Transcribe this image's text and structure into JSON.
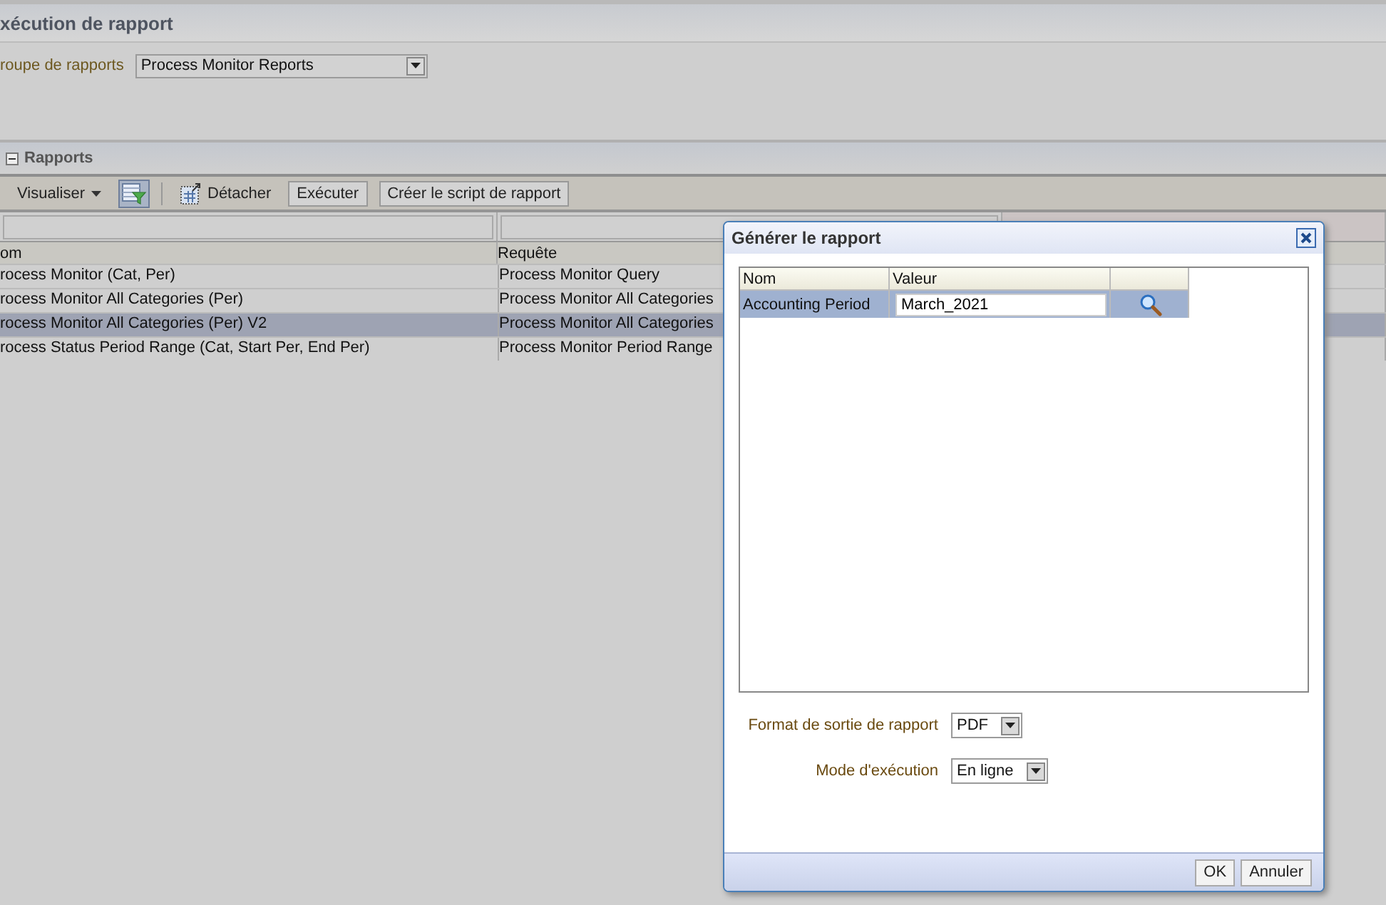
{
  "page": {
    "title": "xécution de rapport",
    "report_group": {
      "label": "roupe de rapports",
      "value": "Process Monitor Reports"
    }
  },
  "section": {
    "title": "Rapports",
    "expanded": true
  },
  "toolbar": {
    "view_menu": "Visualiser",
    "filter_selected": true,
    "detach": "Détacher",
    "buttons": [
      "Exécuter",
      "Créer le script de rapport"
    ]
  },
  "table": {
    "columns": [
      "om",
      "Requête"
    ],
    "rows": [
      {
        "name": "rocess Monitor (Cat, Per)",
        "query": "Process Monitor Query",
        "selected": false
      },
      {
        "name": "rocess Monitor All Categories (Per)",
        "query": "Process Monitor All Categories",
        "selected": false
      },
      {
        "name": "rocess Monitor All Categories (Per) V2",
        "query": "Process Monitor All Categories",
        "selected": true
      },
      {
        "name": "rocess Status Period Range (Cat, Start Per, End Per)",
        "query": "Process Monitor Period Range",
        "selected": false
      }
    ]
  },
  "dialog": {
    "title": "Générer le rapport",
    "params": {
      "columns": [
        "Nom",
        "Valeur"
      ],
      "rows": [
        {
          "name": "Accounting Period",
          "value": "March_2021",
          "selected": true
        }
      ]
    },
    "fields": [
      {
        "label": "Format de sortie de rapport",
        "value": "PDF"
      },
      {
        "label": "Mode d'exécution",
        "value": "En ligne"
      }
    ],
    "buttons": [
      "OK",
      "Annuler"
    ]
  }
}
